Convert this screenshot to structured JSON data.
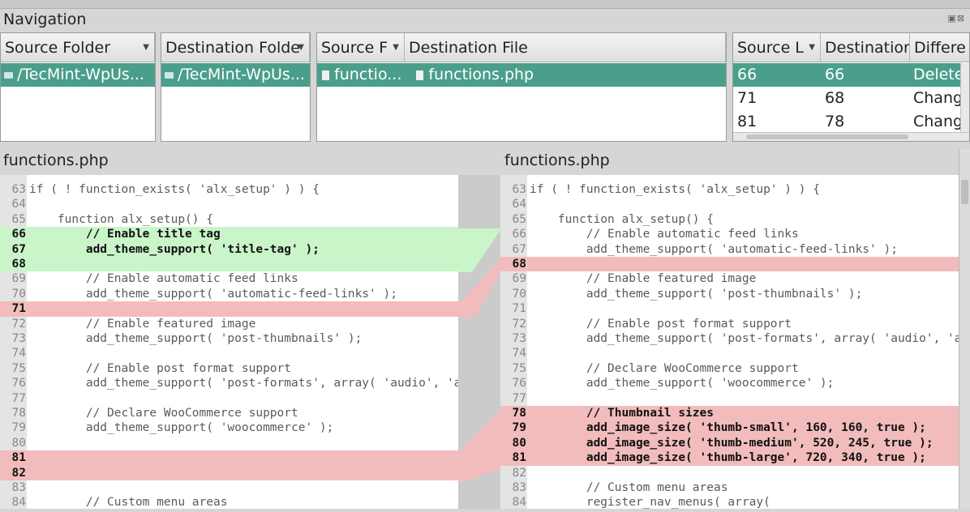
{
  "navigation": {
    "title": "Navigation"
  },
  "folders": {
    "source_header": "Source Folder",
    "destination_header": "Destination Folde",
    "source_value": "/TecMint-WpUs...",
    "destination_value": "/TecMint-WpUs..."
  },
  "files": {
    "source_header": "Source F",
    "destination_header": "Destination File",
    "source_value": "functio...",
    "destination_value": "functions.php"
  },
  "diffs": {
    "headers": [
      "Source L",
      "Destination",
      "Differe"
    ],
    "rows": [
      {
        "src": "66",
        "dst": "66",
        "diff": "Delete"
      },
      {
        "src": "71",
        "dst": "68",
        "diff": "Chang"
      },
      {
        "src": "81",
        "dst": "78",
        "diff": "Chang"
      }
    ]
  },
  "left_editor": {
    "title": "functions.php",
    "lines": [
      {
        "n": "63",
        "t": "if ( ! function_exists( 'alx_setup' ) ) {"
      },
      {
        "n": "64",
        "t": ""
      },
      {
        "n": "65",
        "t": "    function alx_setup() {"
      },
      {
        "n": "66",
        "t": "        // Enable title tag"
      },
      {
        "n": "67",
        "t": "        add_theme_support( 'title-tag' );"
      },
      {
        "n": "68",
        "t": ""
      },
      {
        "n": "69",
        "t": "        // Enable automatic feed links"
      },
      {
        "n": "70",
        "t": "        add_theme_support( 'automatic-feed-links' );"
      },
      {
        "n": "71",
        "t": ""
      },
      {
        "n": "72",
        "t": "        // Enable featured image"
      },
      {
        "n": "73",
        "t": "        add_theme_support( 'post-thumbnails' );"
      },
      {
        "n": "74",
        "t": ""
      },
      {
        "n": "75",
        "t": "        // Enable post format support"
      },
      {
        "n": "76",
        "t": "        add_theme_support( 'post-formats', array( 'audio', 'a"
      },
      {
        "n": "77",
        "t": ""
      },
      {
        "n": "78",
        "t": "        // Declare WooCommerce support"
      },
      {
        "n": "79",
        "t": "        add_theme_support( 'woocommerce' );"
      },
      {
        "n": "80",
        "t": ""
      },
      {
        "n": "81",
        "t": ""
      },
      {
        "n": "82",
        "t": ""
      },
      {
        "n": "83",
        "t": ""
      },
      {
        "n": "84",
        "t": "        // Custom menu areas"
      }
    ]
  },
  "right_editor": {
    "title": "functions.php",
    "lines": [
      {
        "n": "63",
        "t": "if ( ! function_exists( 'alx_setup' ) ) {"
      },
      {
        "n": "64",
        "t": ""
      },
      {
        "n": "65",
        "t": "    function alx_setup() {"
      },
      {
        "n": "66",
        "t": "        // Enable automatic feed links"
      },
      {
        "n": "67",
        "t": "        add_theme_support( 'automatic-feed-links' );"
      },
      {
        "n": "68",
        "t": ""
      },
      {
        "n": "69",
        "t": "        // Enable featured image"
      },
      {
        "n": "70",
        "t": "        add_theme_support( 'post-thumbnails' );"
      },
      {
        "n": "71",
        "t": ""
      },
      {
        "n": "72",
        "t": "        // Enable post format support"
      },
      {
        "n": "73",
        "t": "        add_theme_support( 'post-formats', array( 'audio', 'a"
      },
      {
        "n": "74",
        "t": ""
      },
      {
        "n": "75",
        "t": "        // Declare WooCommerce support"
      },
      {
        "n": "76",
        "t": "        add_theme_support( 'woocommerce' );"
      },
      {
        "n": "77",
        "t": ""
      },
      {
        "n": "78",
        "t": "        // Thumbnail sizes"
      },
      {
        "n": "79",
        "t": "        add_image_size( 'thumb-small', 160, 160, true );"
      },
      {
        "n": "80",
        "t": "        add_image_size( 'thumb-medium', 520, 245, true );"
      },
      {
        "n": "81",
        "t": "        add_image_size( 'thumb-large', 720, 340, true );"
      },
      {
        "n": "82",
        "t": ""
      },
      {
        "n": "83",
        "t": "        // Custom menu areas"
      },
      {
        "n": "84",
        "t": "        register_nav_menus( array("
      }
    ]
  },
  "colors": {
    "selection": "#4a9f8b",
    "insert": "#c9f5c9",
    "delete": "#f2bcbc"
  }
}
